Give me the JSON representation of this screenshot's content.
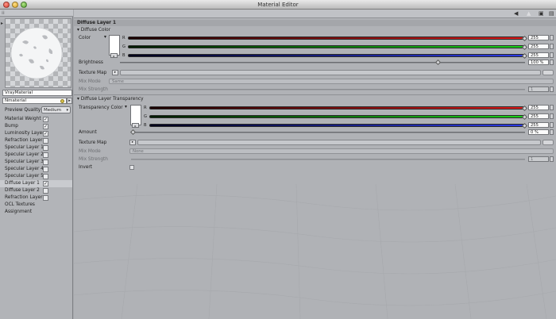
{
  "window": {
    "title": "Material Editor"
  },
  "left_panel": {
    "material_name": "VrayMaterial",
    "node_name": "Nmaterial",
    "preview_quality": {
      "label": "Preview Quality",
      "value": "Medium"
    },
    "channels": [
      {
        "label": "Material Weight",
        "checked": true
      },
      {
        "label": "Bump",
        "checked": true
      },
      {
        "label": "Luminosity Layer",
        "checked": true
      },
      {
        "label": "Refraction Layer",
        "checked": false
      },
      {
        "label": "Specular Layer 1",
        "checked": false
      },
      {
        "label": "Specular Layer 2",
        "checked": false
      },
      {
        "label": "Specular Layer 3",
        "checked": false
      },
      {
        "label": "Specular Layer 4",
        "checked": false
      },
      {
        "label": "Specular Layer 5",
        "checked": false
      },
      {
        "label": "Diffuse Layer 1",
        "checked": true
      },
      {
        "label": "Diffuse Layer 2",
        "checked": false
      },
      {
        "label": "Refraction Layer",
        "checked": false
      }
    ],
    "extra_items": [
      "OCL Textures",
      "Assignment"
    ]
  },
  "right_panel": {
    "header": "Diffuse Layer 1",
    "diffuse_color": {
      "group_label": "Diffuse Color",
      "color_label": "Color",
      "channels": [
        {
          "name": "R",
          "value": "255",
          "fraction": 1.0
        },
        {
          "name": "G",
          "value": "255",
          "fraction": 1.0
        },
        {
          "name": "B",
          "value": "255",
          "fraction": 1.0
        }
      ],
      "brightness_label": "Brightness",
      "brightness_value": "100 %",
      "brightness_fraction": 0.78,
      "texture_map_label": "Texture Map",
      "mix_mode_label": "Mix Mode",
      "mix_mode_value": "Same",
      "mix_strength_label": "Mix Strength",
      "mix_strength_value": "1"
    },
    "transparency": {
      "group_label": "Diffuse Layer Transparency",
      "color_label": "Transparency Color",
      "channels": [
        {
          "name": "R",
          "value": "255",
          "fraction": 1.0
        },
        {
          "name": "G",
          "value": "255",
          "fraction": 1.0
        },
        {
          "name": "B",
          "value": "255",
          "fraction": 1.0
        }
      ],
      "amount_label": "Amount",
      "amount_value": "0 %",
      "amount_fraction": 0.0,
      "texture_map_label": "Texture Map",
      "mix_mode_label": "Mix Mode",
      "mix_mode_value": "None",
      "mix_strength_label": "Mix Strength",
      "mix_strength_value": "1",
      "invert_label": "Invert"
    }
  }
}
